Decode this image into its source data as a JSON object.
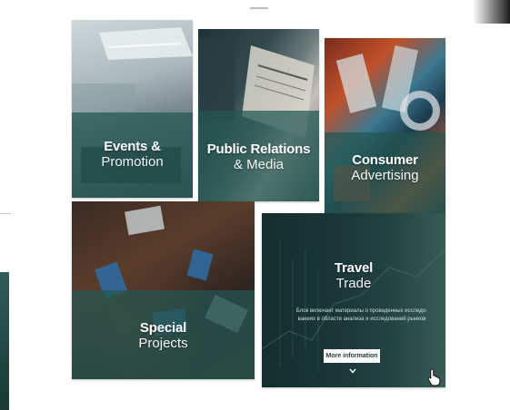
{
  "tiles": [
    {
      "id": "events",
      "title_strong": "Events &",
      "title_light": "Promotion"
    },
    {
      "id": "public-relations",
      "title_strong": "Public Relations",
      "title_light": "& Media"
    },
    {
      "id": "consumer",
      "title_strong": "Consumer",
      "title_light": "Advertising"
    },
    {
      "id": "special",
      "title_strong": "Special",
      "title_light": "Projects"
    },
    {
      "id": "travel",
      "title_strong": "Travel",
      "title_light": "Trade",
      "description": "Блок включает материалы о проведенных исследо-ваниях в области анализа и исследований рынков",
      "button_label": "More information"
    }
  ],
  "icons": {
    "chevron": "chevron-down-icon",
    "cursor": "hand-pointer-icon"
  },
  "colors": {
    "overlay": "#225650",
    "button_text": "#1d3a38"
  }
}
